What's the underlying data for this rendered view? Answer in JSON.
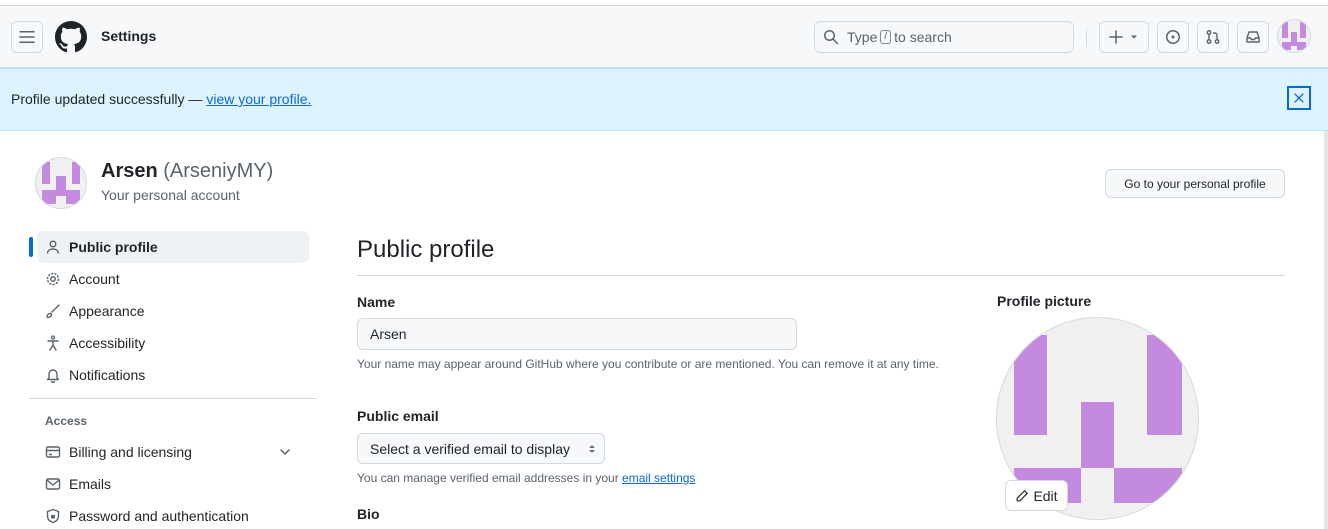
{
  "header": {
    "title": "Settings",
    "search_prefix": "Type",
    "search_key": "/",
    "search_suffix": "to search"
  },
  "flash": {
    "message": "Profile updated successfully — ",
    "link_text": "view your profile."
  },
  "account": {
    "name": "Arsen",
    "login": "(ArseniyMY)",
    "subtitle": "Your personal account",
    "go_to_profile_label": "Go to your personal profile"
  },
  "sidebar": {
    "items": [
      {
        "label": "Public profile"
      },
      {
        "label": "Account"
      },
      {
        "label": "Appearance"
      },
      {
        "label": "Accessibility"
      },
      {
        "label": "Notifications"
      }
    ],
    "access_heading": "Access",
    "access_items": [
      {
        "label": "Billing and licensing"
      },
      {
        "label": "Emails"
      },
      {
        "label": "Password and authentication"
      }
    ]
  },
  "main": {
    "title": "Public profile",
    "name_label": "Name",
    "name_value": "Arsen",
    "name_note": "Your name may appear around GitHub where you contribute or are mentioned. You can remove it at any time.",
    "email_label": "Public email",
    "email_select_value": "Select a verified email to display",
    "email_note_prefix": "You can manage verified email addresses in your ",
    "email_note_link": "email settings",
    "bio_label": "Bio",
    "picture_label": "Profile picture",
    "edit_label": "Edit"
  },
  "colors": {
    "accent": "#0969da",
    "identicon": "#c48ae0",
    "flash_bg": "#ddf4ff"
  }
}
